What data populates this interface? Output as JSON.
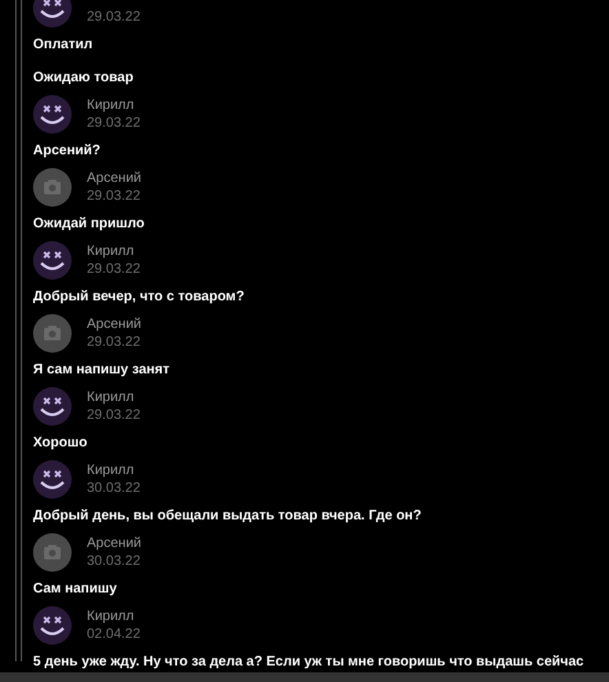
{
  "messages": [
    {
      "kind": "smiley",
      "date": "29.03.22",
      "texts": [
        "Оплатил",
        "Ожидаю товар"
      ]
    },
    {
      "author": "Кирилл",
      "kind": "smiley",
      "date": "29.03.22",
      "texts": [
        "Арсений?"
      ]
    },
    {
      "author": "Арсений",
      "kind": "camera",
      "date": "29.03.22",
      "texts": [
        "Ожидай пришло"
      ]
    },
    {
      "author": "Кирилл",
      "kind": "smiley",
      "date": "29.03.22",
      "texts": [
        "Добрый вечер, что с товаром?"
      ]
    },
    {
      "author": "Арсений",
      "kind": "camera",
      "date": "29.03.22",
      "texts": [
        "Я сам напишу занят"
      ]
    },
    {
      "author": "Кирилл",
      "kind": "smiley",
      "date": "29.03.22",
      "texts": [
        "Хорошо"
      ]
    },
    {
      "author": "Кирилл",
      "kind": "smiley",
      "date": "30.03.22",
      "texts": [
        "Добрый день, вы обещали выдать товар вчера. Где он?"
      ]
    },
    {
      "author": "Арсений",
      "kind": "camera",
      "date": "30.03.22",
      "texts": [
        "Сам напишу"
      ]
    },
    {
      "author": "Кирилл",
      "kind": "smiley",
      "date": "02.04.22",
      "texts": [
        "5 день уже жду. Ну что за дела а? Если уж ты мне говоришь что выдашь сейчас"
      ]
    }
  ]
}
